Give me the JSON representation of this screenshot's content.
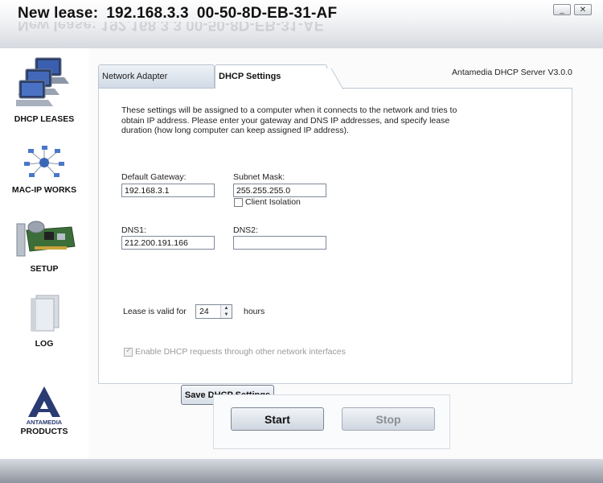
{
  "window": {
    "title_label": "New lease:",
    "title_ip": "192.168.3.3",
    "title_mac": "00-50-8D-EB-31-AF",
    "minimize_glyph": "_",
    "close_glyph": "✕"
  },
  "sidebar": {
    "items": [
      {
        "label": "DHCP LEASES",
        "icon": "computers-icon"
      },
      {
        "label": "MAC-IP WORKS",
        "icon": "network-icon"
      },
      {
        "label": "SETUP",
        "icon": "network-card-icon"
      },
      {
        "label": "LOG",
        "icon": "log-icon"
      },
      {
        "label": "PRODUCTS",
        "icon": "antamedia-logo",
        "logo_text": "ANTAMEDIA"
      }
    ]
  },
  "tabs": [
    {
      "label": "Network Adapter",
      "active": false
    },
    {
      "label": "DHCP Settings",
      "active": true
    }
  ],
  "version": "Antamedia DHCP Server V3.0.0",
  "dhcp": {
    "description": "These settings will be assigned to a computer when it connects to the network and tries to obtain IP address. Please enter your gateway and DNS IP addresses, and specify lease duration (how long computer can keep assigned IP address).",
    "gateway_label": "Default Gateway:",
    "gateway_value": "192.168.3.1",
    "subnet_label": "Subnet Mask:",
    "subnet_value": "255.255.255.0",
    "client_isolation_label": "Client Isolation",
    "client_isolation_checked": false,
    "dns1_label": "DNS1:",
    "dns1_value": "212.200.191.166",
    "dns2_label": "DNS2:",
    "dns2_value": "",
    "lease_prefix": "Lease is valid for",
    "lease_value": "24",
    "lease_suffix": "hours",
    "enable_other_label": "Enable DHCP requests through other network interfaces",
    "enable_other_checked": true,
    "save_button": "Save DHCP Settings"
  },
  "controls": {
    "start_label": "Start",
    "stop_label": "Stop",
    "stop_disabled": true
  },
  "colors": {
    "panel_border": "#b9c4d2",
    "bottom_bar": "#8e949e"
  }
}
